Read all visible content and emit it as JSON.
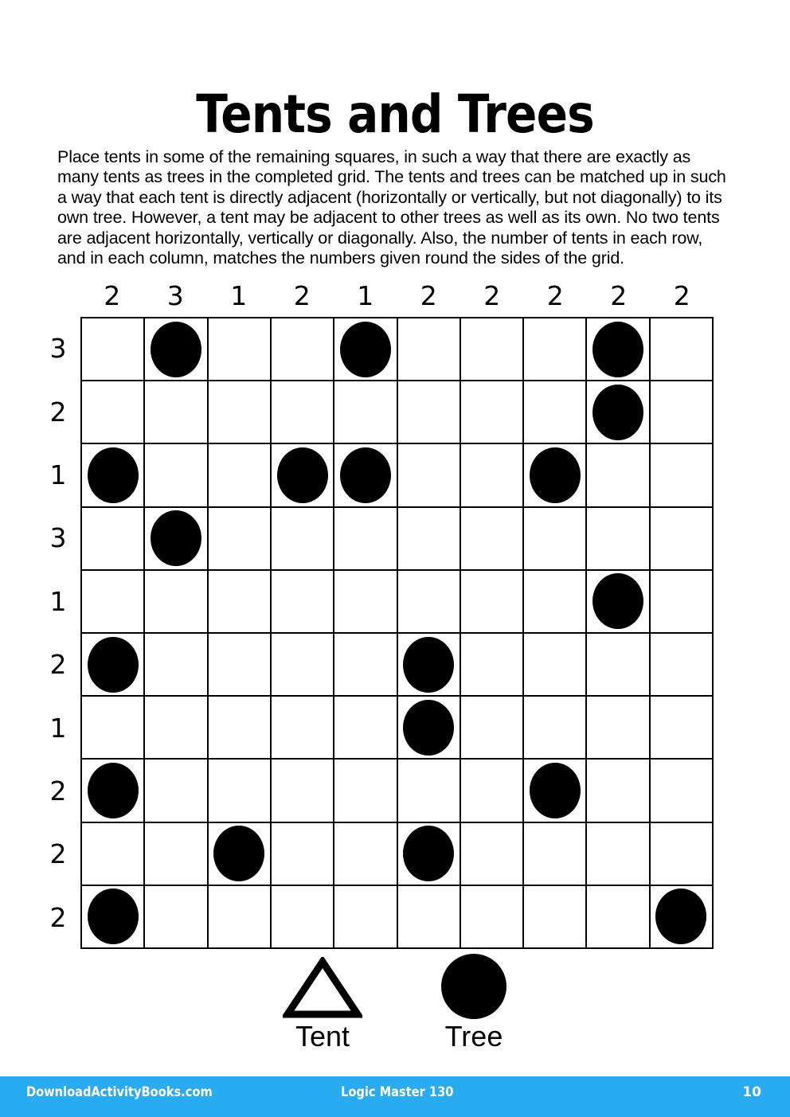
{
  "page": {
    "title": "Tents and Trees",
    "instructions": "Place tents in some of the remaining squares, in such a way that there are exactly as many tents as trees in the completed grid. The tents and trees can be matched up in such a way that each tent is directly adjacent (horizontally or vertically, but not diagonally) to its own tree. However, a tent may be adjacent to other trees as well as its own. No two tents are adjacent horizontally, vertically or diagonally. Also, the number of tents in each row, and in each column, matches the numbers given round the sides of the grid."
  },
  "puzzle": {
    "rows": 10,
    "columns": 10,
    "column_clues": [
      2,
      3,
      1,
      2,
      1,
      2,
      2,
      2,
      2,
      2
    ],
    "row_clues": [
      3,
      2,
      1,
      3,
      1,
      2,
      1,
      2,
      2,
      2
    ],
    "tree_cells": [
      [
        0,
        1
      ],
      [
        0,
        4
      ],
      [
        0,
        8
      ],
      [
        1,
        8
      ],
      [
        2,
        0
      ],
      [
        2,
        3
      ],
      [
        2,
        4
      ],
      [
        2,
        7
      ],
      [
        3,
        1
      ],
      [
        4,
        8
      ],
      [
        5,
        0
      ],
      [
        5,
        5
      ],
      [
        6,
        5
      ],
      [
        7,
        0
      ],
      [
        7,
        7
      ],
      [
        8,
        2
      ],
      [
        8,
        5
      ],
      [
        9,
        0
      ],
      [
        9,
        9
      ]
    ]
  },
  "legend": {
    "tent_label": "Tent",
    "tree_label": "Tree"
  },
  "footer": {
    "site": "DownloadActivityBooks.com",
    "book": "Logic Master 130",
    "page_number": "10",
    "background_color": "#29abf2"
  }
}
